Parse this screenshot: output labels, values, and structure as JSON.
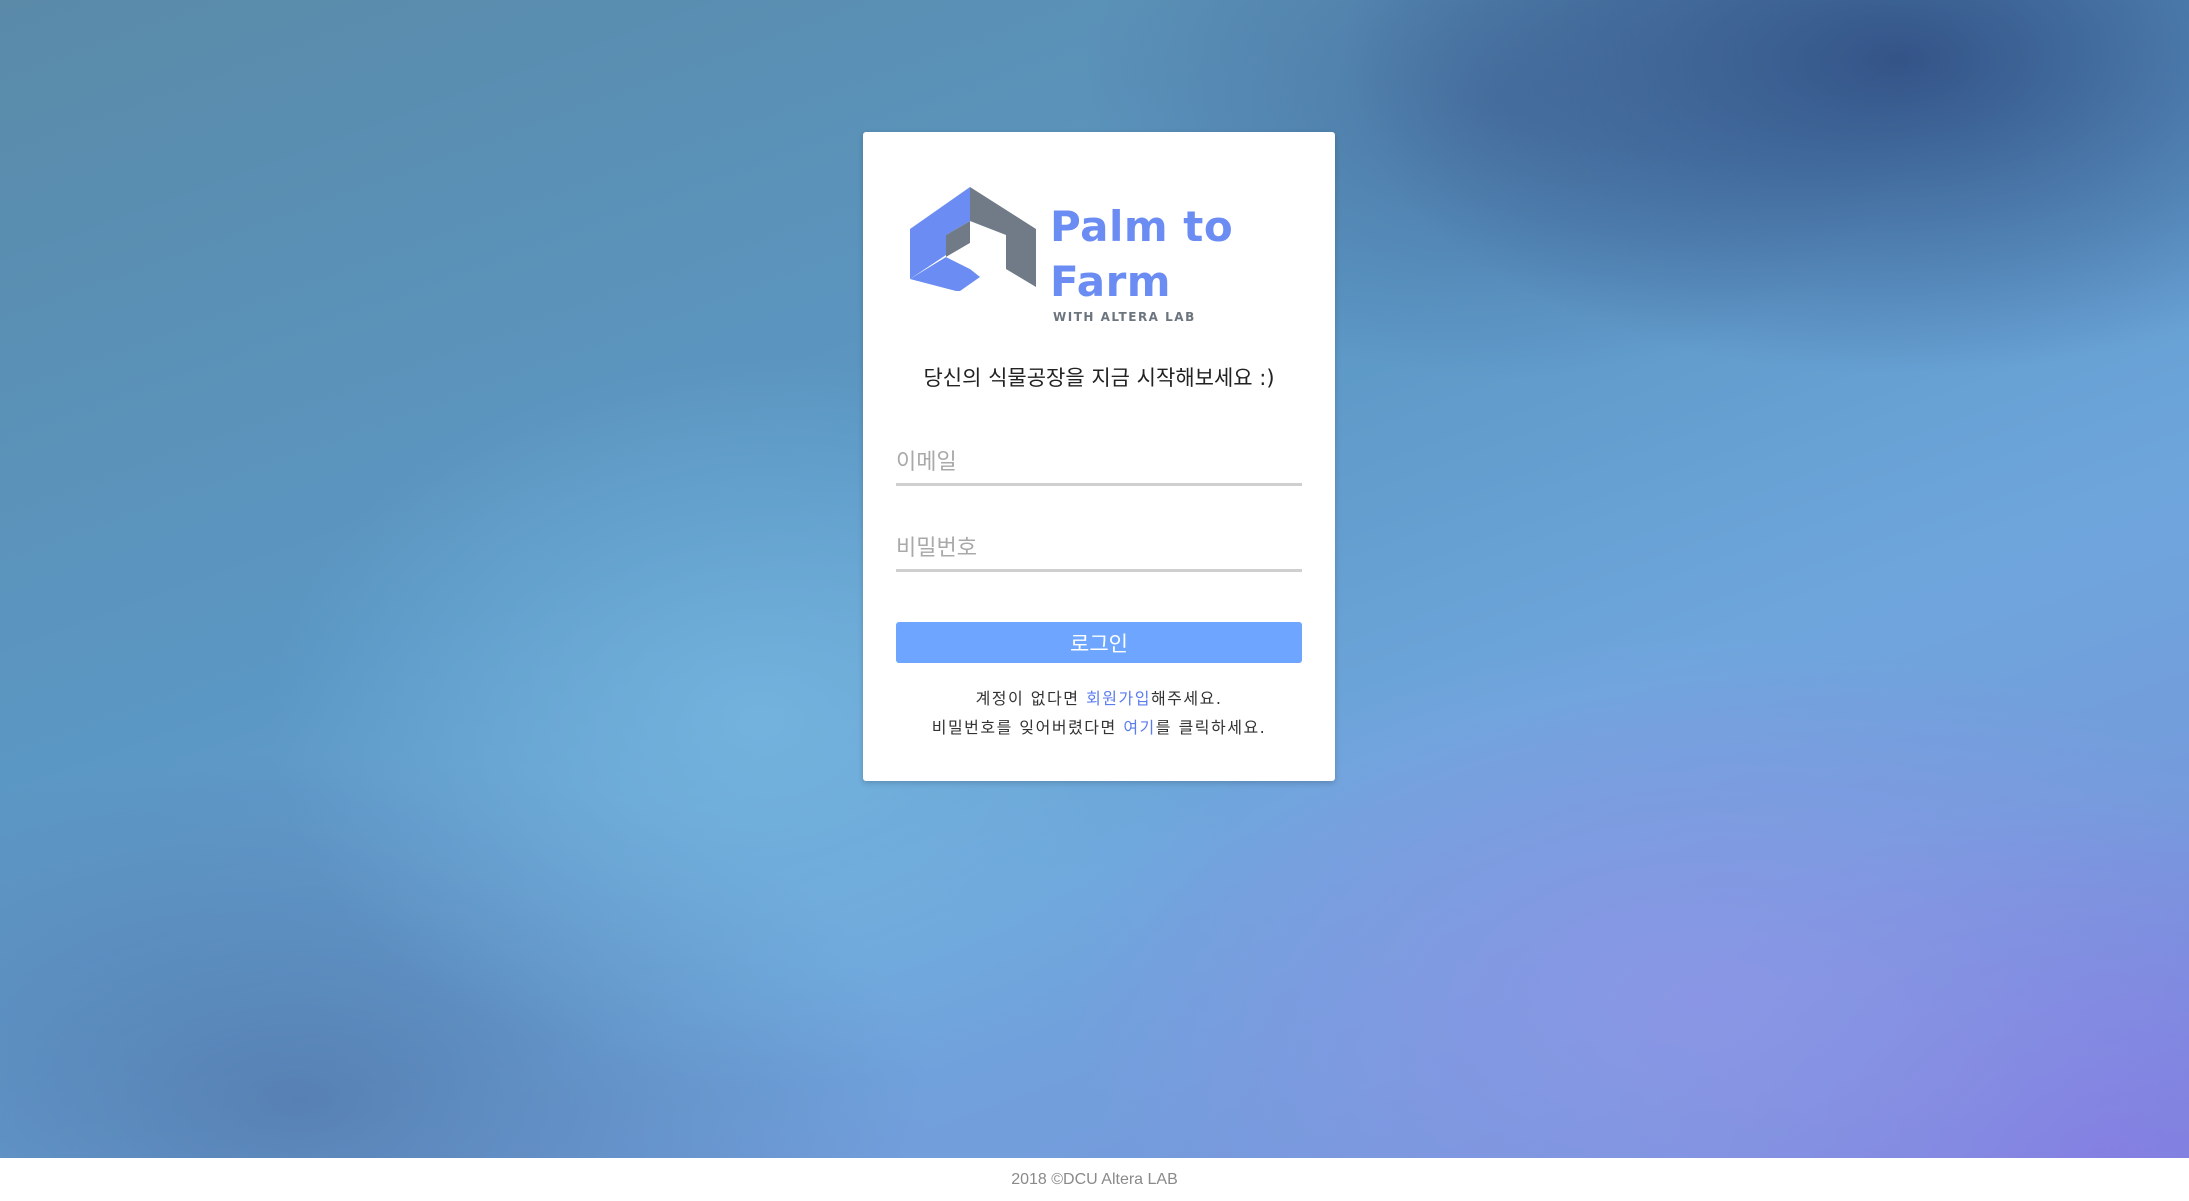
{
  "brand": {
    "title_line1": "Palm to",
    "title_line2": "Farm",
    "subtitle": "WITH ALTERA LAB",
    "colors": {
      "primary": "#6b8cf2",
      "dark": "#6c757d"
    }
  },
  "login": {
    "tagline": "당신의 식물공장을 지금 시작해보세요 :)",
    "email_placeholder": "이메일",
    "password_placeholder": "비밀번호",
    "submit_label": "로그인",
    "button_color": "#6ea6ff",
    "signup_prefix": "계정이 없다면 ",
    "signup_link": "회원가입",
    "signup_suffix": "해주세요.",
    "forgot_prefix": "비밀번호를 잊어버렸다면 ",
    "forgot_link": "여기",
    "forgot_suffix": "를 클릭하세요."
  },
  "footer": {
    "text": "2018 ©DCU Altera LAB"
  }
}
